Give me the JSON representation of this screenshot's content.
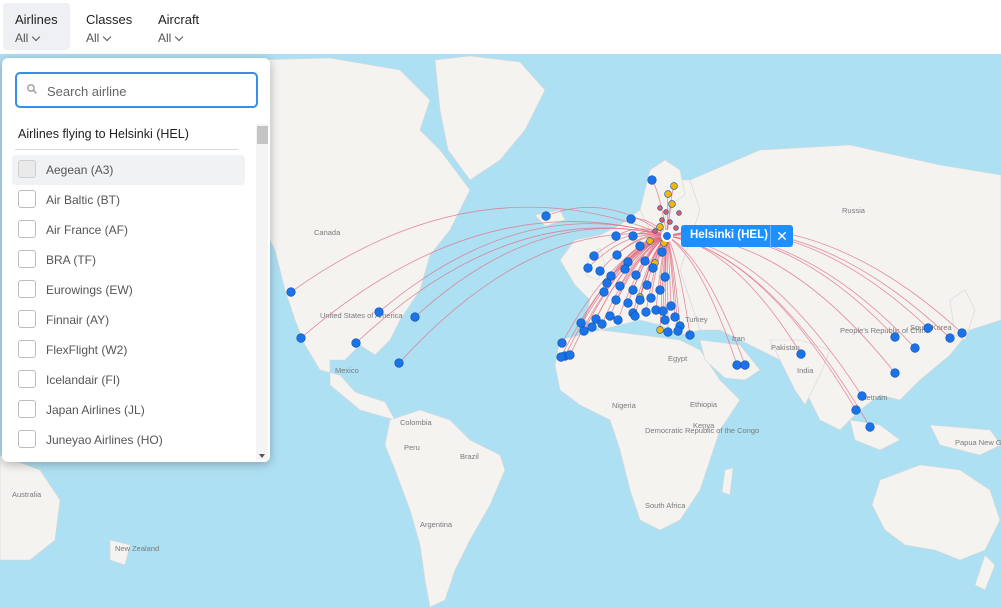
{
  "filters": [
    {
      "title": "Airlines",
      "value": "All"
    },
    {
      "title": "Classes",
      "value": "All"
    },
    {
      "title": "Aircraft",
      "value": "All"
    }
  ],
  "panel": {
    "search_placeholder": "Search airline",
    "title": "Airlines flying to Helsinki (HEL)",
    "airlines": [
      "Aegean (A3)",
      "Air Baltic (BT)",
      "Air France (AF)",
      "BRA (TF)",
      "Eurowings (EW)",
      "Finnair (AY)",
      "FlexFlight (W2)",
      "Icelandair (FI)",
      "Japan Airlines (JL)",
      "Juneyao Airlines (HO)"
    ]
  },
  "map": {
    "selected_airport": "Helsinki (HEL)",
    "labels": [
      "Canada",
      "United States of America",
      "Mexico",
      "Colombia",
      "Peru",
      "Brazil",
      "Argentina",
      "Russia",
      "Turkey",
      "Egypt",
      "Iran",
      "Pakistan",
      "India",
      "Nigeria",
      "Ethiopia",
      "Kenya",
      "Democratic Republic of the Congo",
      "South Africa",
      "People's Republic of China",
      "South Korea",
      "Vietnam",
      "Papua New Guinea",
      "Australia",
      "New Zealand"
    ],
    "colors": {
      "ocean": "#aee0f3",
      "land": "#f4f3f0",
      "route": "#e06b7f",
      "airport_blue": "#1a73e8",
      "airport_yellow": "#f2b705",
      "airport_red": "#d95f5f",
      "accent": "#1e8fff"
    }
  }
}
